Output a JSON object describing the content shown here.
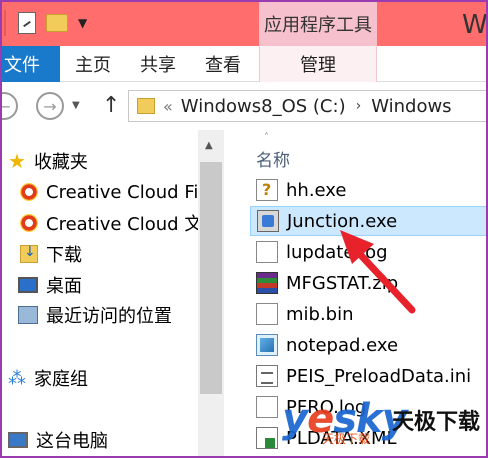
{
  "window": {
    "title_partial": "W",
    "context_tab_group": "应用程序工具"
  },
  "ribbon": {
    "tabs": [
      {
        "label": "文件"
      },
      {
        "label": "主页"
      },
      {
        "label": "共享"
      },
      {
        "label": "查看"
      },
      {
        "label": "管理"
      }
    ]
  },
  "address": {
    "chevron": "«",
    "segments": [
      "Windows8_OS (C:)",
      "Windows"
    ],
    "separator": "›"
  },
  "nav": {
    "items": [
      {
        "label": "收藏夹",
        "icon": "star-icon"
      },
      {
        "label": "Creative Cloud Files",
        "icon": "creative-cloud-icon"
      },
      {
        "label": "Creative Cloud 文件",
        "icon": "creative-cloud-icon"
      },
      {
        "label": "下载",
        "icon": "downloads-folder-icon"
      },
      {
        "label": "桌面",
        "icon": "desktop-icon"
      },
      {
        "label": "最近访问的位置",
        "icon": "recent-places-icon"
      },
      {
        "label": "家庭组",
        "icon": "homegroup-icon"
      },
      {
        "label": "这台电脑",
        "icon": "this-pc-icon"
      }
    ]
  },
  "files": {
    "column_header": "名称",
    "items": [
      {
        "name": "hh.exe",
        "icon": "help-exe-icon",
        "selected": false
      },
      {
        "name": "Junction.exe",
        "icon": "exe-icon",
        "selected": true
      },
      {
        "name": "lupdate.log",
        "icon": "document-icon",
        "selected": false
      },
      {
        "name": "MFGSTAT.zip",
        "icon": "winrar-zip-icon",
        "selected": false
      },
      {
        "name": "mib.bin",
        "icon": "document-icon",
        "selected": false
      },
      {
        "name": "notepad.exe",
        "icon": "notepad-icon",
        "selected": false
      },
      {
        "name": "PEIS_PreloadData.ini",
        "icon": "ini-icon",
        "selected": false
      },
      {
        "name": "PFRO.log",
        "icon": "document-icon",
        "selected": false
      },
      {
        "name": "PLDATA.XML",
        "icon": "xml-icon",
        "selected": false
      }
    ]
  },
  "watermark": {
    "brand_prefix": "y",
    "brand_e": "e",
    "brand_suffix": "sky",
    "brand_cn": "天极下载",
    "sub": "天极下载"
  },
  "colors": {
    "title_bar": "#ff6d6d",
    "file_tab": "#1979ca",
    "selection": "#cce8ff",
    "annotation_arrow": "#e8222b"
  }
}
